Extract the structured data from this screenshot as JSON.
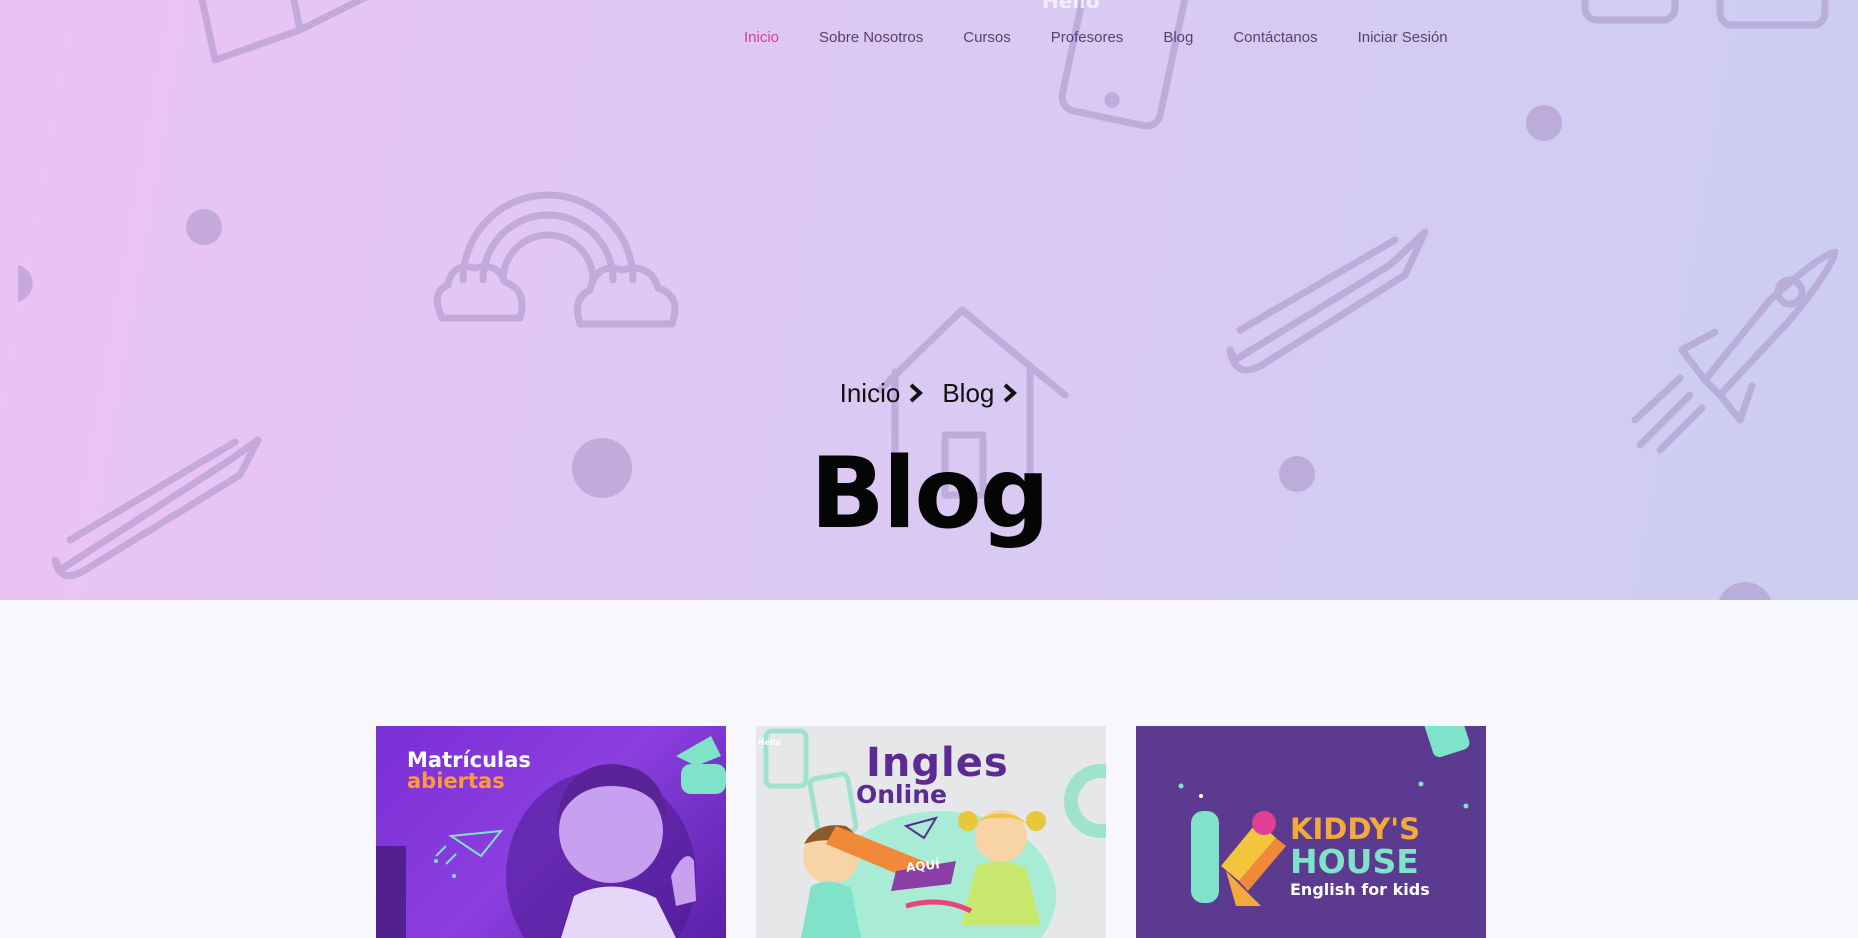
{
  "nav": {
    "items": [
      {
        "label": "Inicio",
        "active": true
      },
      {
        "label": "Sobre Nosotros"
      },
      {
        "label": "Cursos"
      },
      {
        "label": "Profesores"
      },
      {
        "label": "Blog"
      },
      {
        "label": "Contáctanos"
      },
      {
        "label": "Iniciar Sesión"
      }
    ]
  },
  "hero": {
    "breadcrumb": [
      "Inicio",
      "Blog"
    ],
    "title": "Blog",
    "decor_text": "Hello"
  },
  "posts": [
    {
      "line1": "Matrículas",
      "line2": "abiertas"
    },
    {
      "line1": "Ingles",
      "line2": "Online",
      "tag": "AQUÍ",
      "decor_text": "Hello"
    },
    {
      "line1": "KIDDY'S",
      "line2": "HOUSE",
      "line3": "English for kids"
    }
  ],
  "colors": {
    "nav_active": "#d63f95",
    "nav_text": "#5a3d7a",
    "title": "#050505"
  }
}
